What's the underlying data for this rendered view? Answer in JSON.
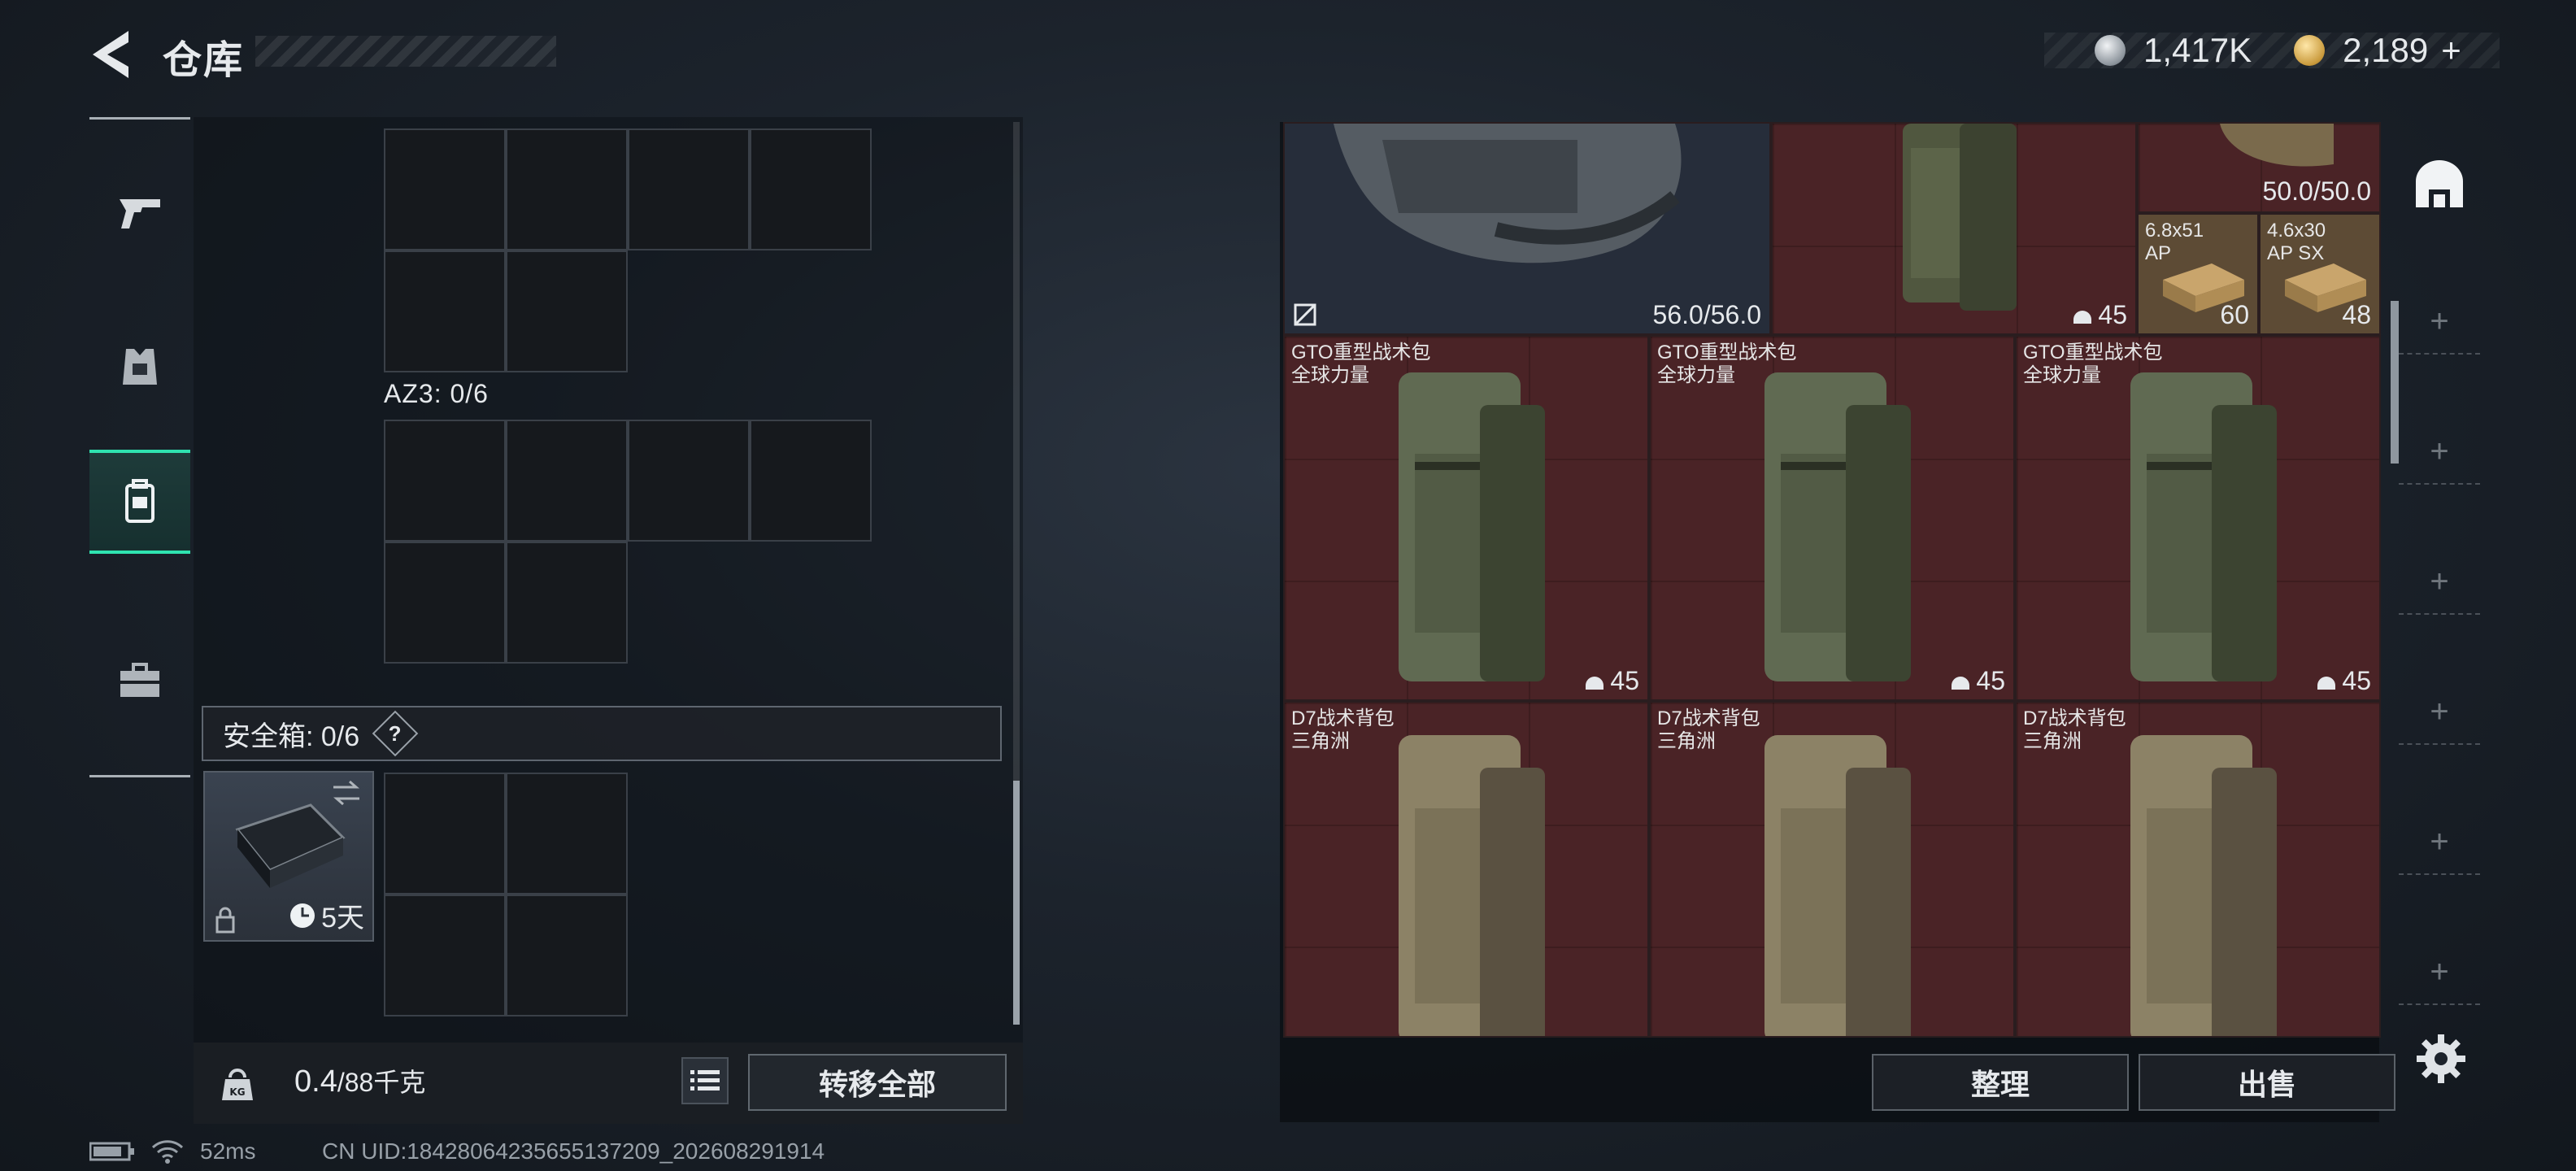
{
  "header": {
    "title": "仓库",
    "currencies": [
      {
        "icon": "silver-coin-icon",
        "value": "1,417K"
      },
      {
        "icon": "gold-coin-icon",
        "value": "2,189",
        "suffix": "+"
      }
    ]
  },
  "left_rail": {
    "items": [
      {
        "icon": "pistol-icon",
        "active": false
      },
      {
        "icon": "armor-rig-icon",
        "active": false
      },
      {
        "icon": "backpack-icon",
        "active": true
      },
      {
        "icon": "toolbox-icon",
        "active": false
      }
    ]
  },
  "loadout": {
    "az3_label": "AZ3: 0/6",
    "secure_label": "安全箱: 0/6",
    "secure_help": "?",
    "case_days": "5天",
    "weight_value": "0.4",
    "weight_unit": "/88千克",
    "transfer_all": "转移全部"
  },
  "stash": {
    "top_row": [
      {
        "count": "56.0/56.0",
        "icon": "no-insure-icon"
      },
      {
        "count": "45",
        "icon": "helmet-icon"
      },
      {
        "count": "50.0/50.0"
      }
    ],
    "ammo": [
      {
        "name_line1": "6.8x51",
        "name_line2": "AP",
        "count": "60"
      },
      {
        "name_line1": "4.6x30",
        "name_line2": "AP SX",
        "count": "48"
      }
    ],
    "row2": [
      {
        "name": "GTO重型战术包",
        "sub": "全球力量",
        "count": "45"
      },
      {
        "name": "GTO重型战术包",
        "sub": "全球力量",
        "count": "45"
      },
      {
        "name": "GTO重型战术包",
        "sub": "全球力量",
        "count": "45"
      }
    ],
    "row3": [
      {
        "name": "D7战术背包",
        "sub": "三角洲"
      },
      {
        "name": "D7战术背包",
        "sub": "三角洲"
      },
      {
        "name": "D7战术背包",
        "sub": "三角洲"
      }
    ],
    "sort": "整理",
    "sell": "出售",
    "plus": "+"
  },
  "status": {
    "ping": "52ms",
    "uid": "CN UID:18428064235655137209_202608291914"
  },
  "colors": {
    "accent": "#2fe3b0",
    "slot_red": "#4a2326",
    "text": "#e6e9ec"
  }
}
